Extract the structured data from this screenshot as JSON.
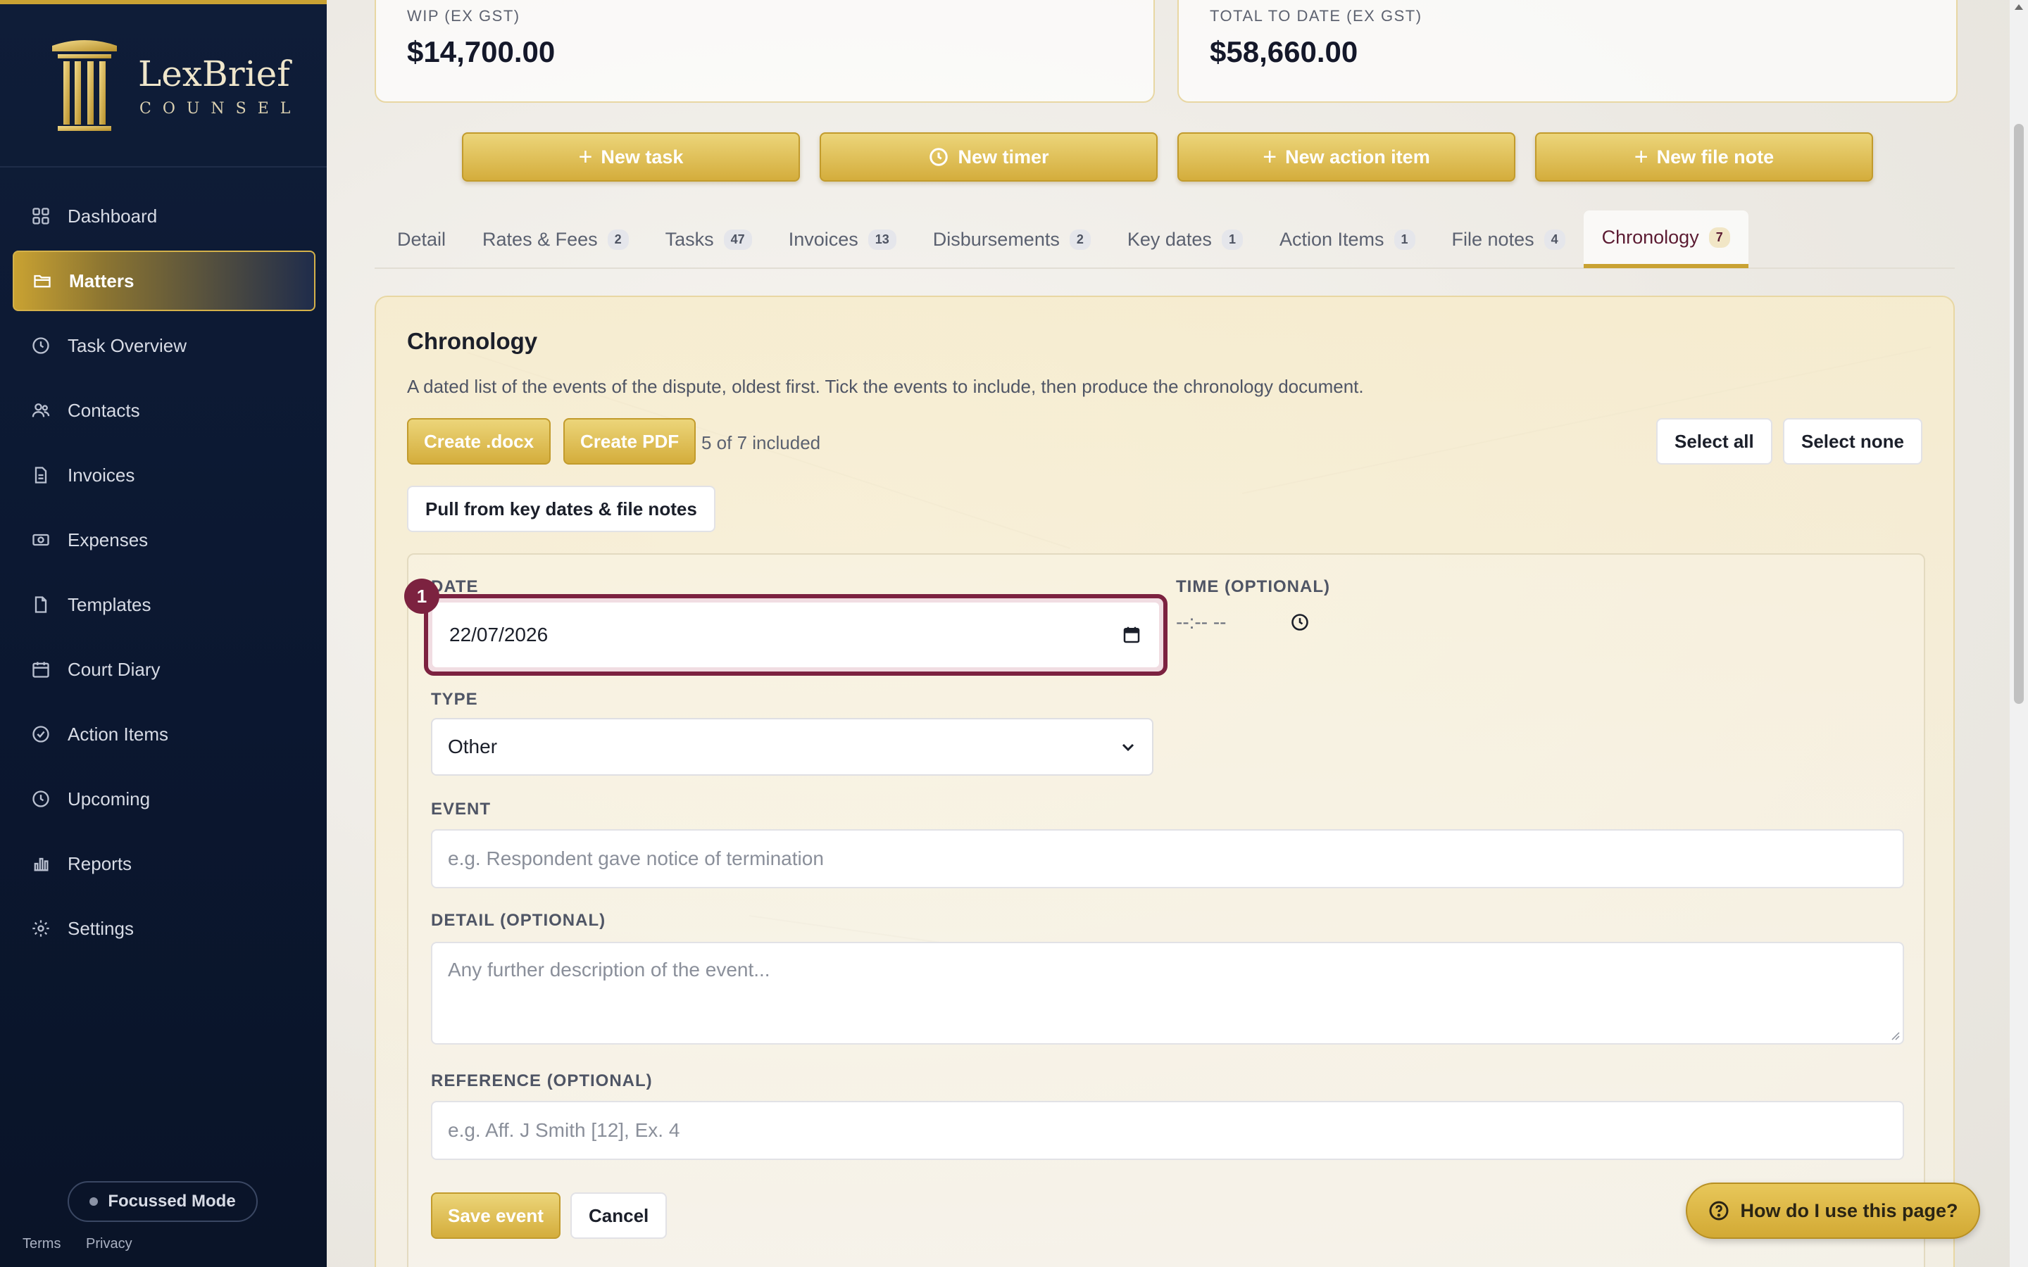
{
  "brand": {
    "name": "LexBrief",
    "sub": "COUNSEL",
    "accent": "#c9a233",
    "burgundy": "#7c2240",
    "navy": "#0f1d38"
  },
  "sidebar": {
    "items": [
      {
        "label": "Dashboard",
        "icon": "grid-icon"
      },
      {
        "label": "Matters",
        "icon": "folder-icon",
        "active": true
      },
      {
        "label": "Task Overview",
        "icon": "clock-icon"
      },
      {
        "label": "Contacts",
        "icon": "users-icon"
      },
      {
        "label": "Invoices",
        "icon": "document-icon"
      },
      {
        "label": "Expenses",
        "icon": "cash-icon"
      },
      {
        "label": "Templates",
        "icon": "file-icon"
      },
      {
        "label": "Court Diary",
        "icon": "calendar-icon"
      },
      {
        "label": "Action Items",
        "icon": "check-circle-icon"
      },
      {
        "label": "Upcoming",
        "icon": "clock-icon"
      },
      {
        "label": "Reports",
        "icon": "bar-chart-icon"
      },
      {
        "label": "Settings",
        "icon": "gear-icon"
      }
    ],
    "focus_mode": "Focussed Mode",
    "footer": {
      "terms": "Terms",
      "privacy": "Privacy"
    }
  },
  "stats": {
    "wip_label": "WIP (EX GST)",
    "wip_value": "$14,700.00",
    "total_label": "TOTAL TO DATE (EX GST)",
    "total_value": "$58,660.00"
  },
  "actions": {
    "new_task": "New task",
    "new_timer": "New timer",
    "new_action_item": "New action item",
    "new_file_note": "New file note"
  },
  "tabs": [
    {
      "label": "Detail",
      "count": ""
    },
    {
      "label": "Rates & Fees",
      "count": "2"
    },
    {
      "label": "Tasks",
      "count": "47"
    },
    {
      "label": "Invoices",
      "count": "13"
    },
    {
      "label": "Disbursements",
      "count": "2"
    },
    {
      "label": "Key dates",
      "count": "1"
    },
    {
      "label": "Action Items",
      "count": "1"
    },
    {
      "label": "File notes",
      "count": "4"
    },
    {
      "label": "Chronology",
      "count": "7",
      "active": true
    }
  ],
  "chronology": {
    "title": "Chronology",
    "description": "A dated list of the events of the dispute, oldest first. Tick the events to include, then produce the chronology document.",
    "create_docx": "Create .docx",
    "create_pdf": "Create PDF",
    "included": "5 of 7 included",
    "select_all": "Select all",
    "select_none": "Select none",
    "pull_button": "Pull from key dates & file notes",
    "form": {
      "step": "1",
      "date_label": "DATE",
      "date_value": "22/07/2026",
      "time_label": "TIME (OPTIONAL)",
      "time_value": "--:-- --",
      "type_label": "TYPE",
      "type_value": "Other",
      "event_label": "EVENT",
      "event_placeholder": "e.g. Respondent gave notice of termination",
      "detail_label": "DETAIL (OPTIONAL)",
      "detail_placeholder": "Any further description of the event...",
      "reference_label": "REFERENCE (OPTIONAL)",
      "reference_placeholder": "e.g. Aff. J Smith [12], Ex. 4",
      "save": "Save event",
      "cancel": "Cancel"
    }
  },
  "help": "How do I use this page?"
}
